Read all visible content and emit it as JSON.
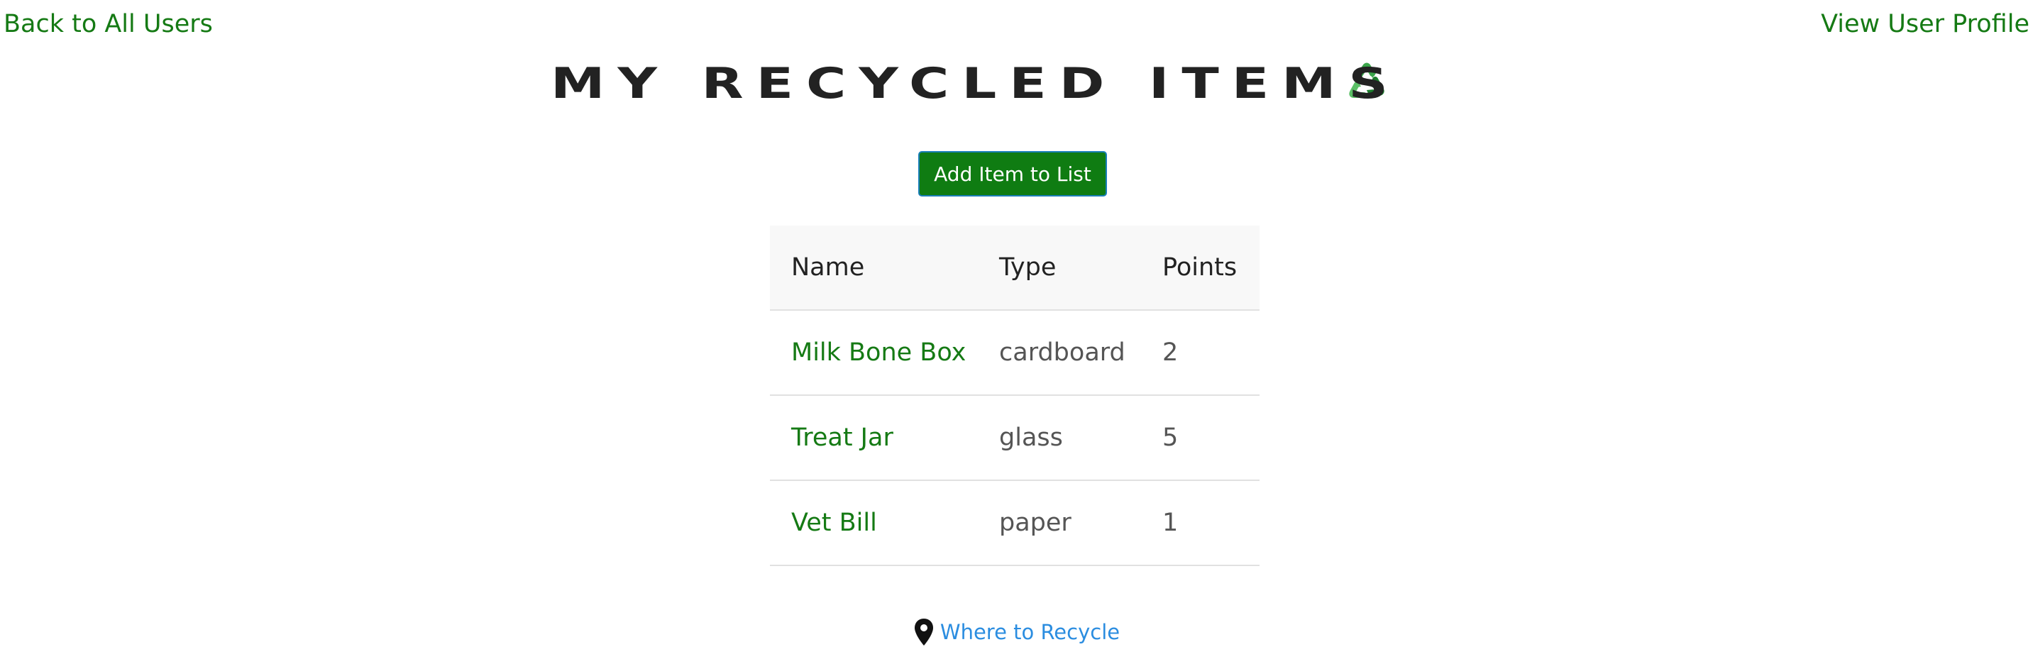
{
  "nav": {
    "back_label": "Back to All Users",
    "profile_label": "View User Profile"
  },
  "header": {
    "title": "MY RECYCLED ITEMS",
    "icon": "recycle-icon"
  },
  "actions": {
    "add_label": "Add Item to List"
  },
  "table": {
    "columns": [
      "Name",
      "Type",
      "Points"
    ],
    "rows": [
      {
        "name": "Milk Bone Box",
        "type": "cardboard",
        "points": "2"
      },
      {
        "name": "Treat Jar",
        "type": "glass",
        "points": "5"
      },
      {
        "name": "Vet Bill",
        "type": "paper",
        "points": "1"
      }
    ]
  },
  "footer": {
    "link_label": "Where to Recycle",
    "icon": "map-pin-icon"
  },
  "colors": {
    "accent_green": "#157a14",
    "button_green": "#0f7c12",
    "link_blue": "#2b8de0"
  }
}
